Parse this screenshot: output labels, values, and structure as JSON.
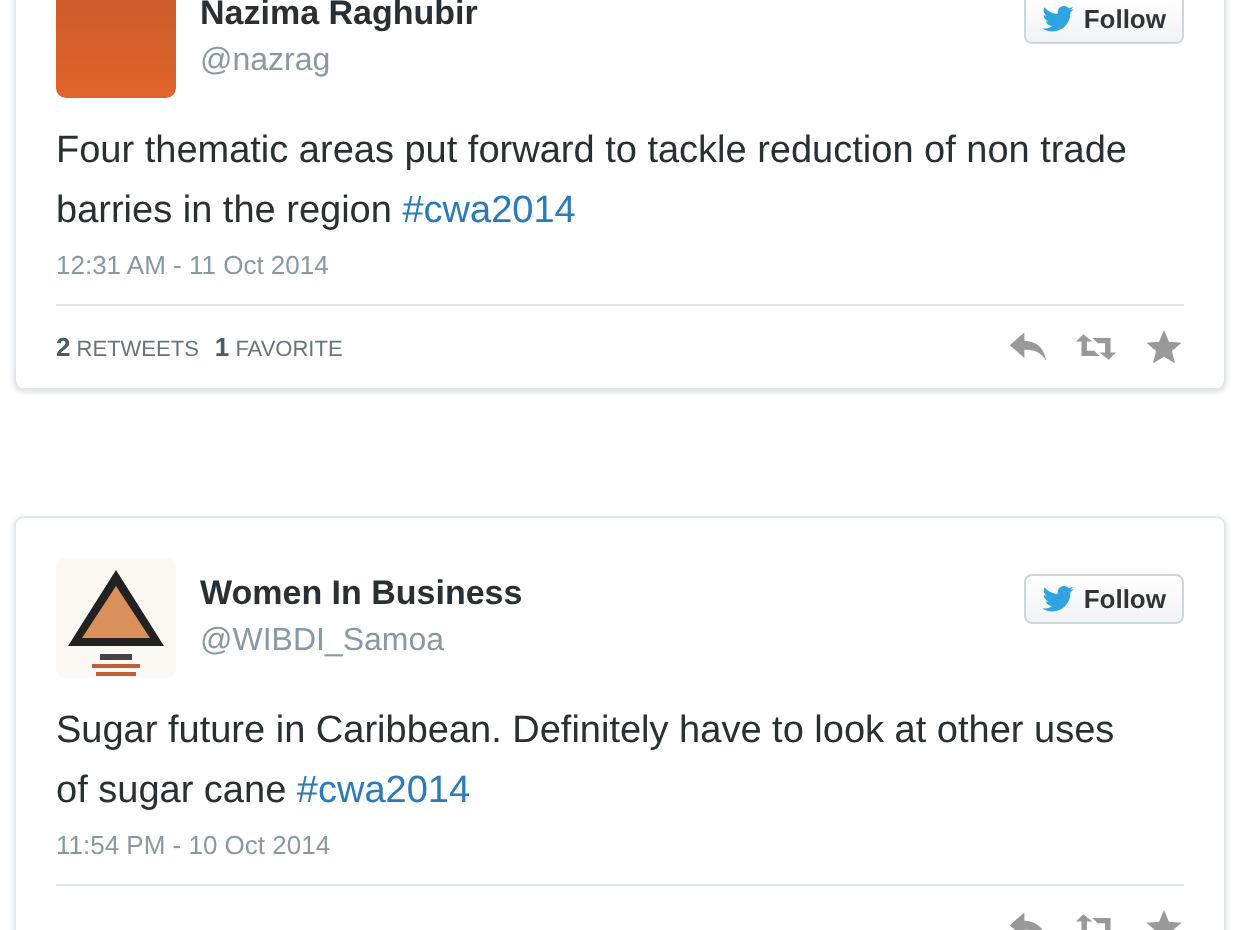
{
  "tweets": [
    {
      "name": "Nazima Raghubir",
      "handle": "@nazrag",
      "avatar": {
        "kind": "photo"
      },
      "follow": "Follow",
      "text": "Four thematic areas put forward to tackle reduction of non trade barries in the region",
      "hashtag": "#cwa2014",
      "time": "12:31 AM - 11 Oct 2014",
      "stats": [
        {
          "count": "2",
          "label": "RETWEETS"
        },
        {
          "count": "1",
          "label": "FAVORITE"
        }
      ]
    },
    {
      "name": "Women In Business",
      "handle": "@WIBDI_Samoa",
      "avatar": {
        "kind": "logo"
      },
      "follow": "Follow",
      "text": "Sugar future in Caribbean. Definitely have to look at other uses of sugar cane",
      "hashtag": "#cwa2014",
      "time": "11:54 PM - 10 Oct 2014"
    }
  ]
}
